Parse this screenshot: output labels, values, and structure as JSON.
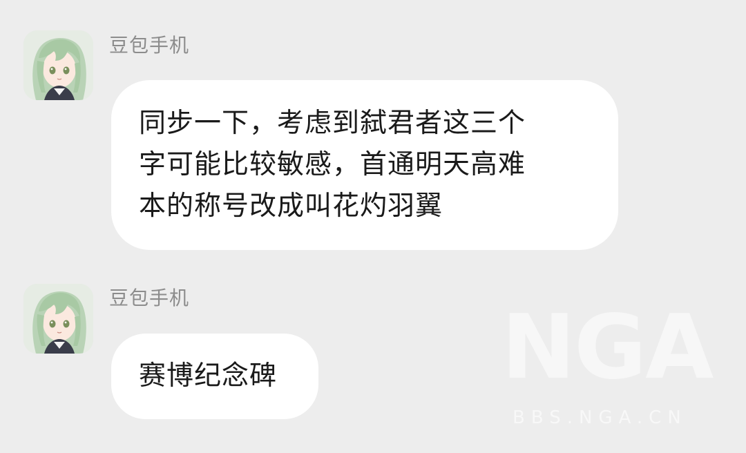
{
  "messages": [
    {
      "sender": "豆包手机",
      "lines": [
        "同步一下，考虑到弑君者这三个",
        "字可能比较敏感，首通明天高难",
        "本的称号改成叫花灼羽翼"
      ],
      "avatar_icon": "anime-girl-avatar-icon"
    },
    {
      "sender": "豆包手机",
      "lines": [
        "赛博纪念碑"
      ],
      "avatar_icon": "anime-girl-avatar-icon"
    }
  ],
  "watermark": {
    "mark": "NGA",
    "url": "BBS.NGA.CN"
  },
  "colors": {
    "background": "#ededed",
    "bubble": "#ffffff",
    "sender_text": "#8c8c8c",
    "message_text": "#1a1a1a"
  }
}
